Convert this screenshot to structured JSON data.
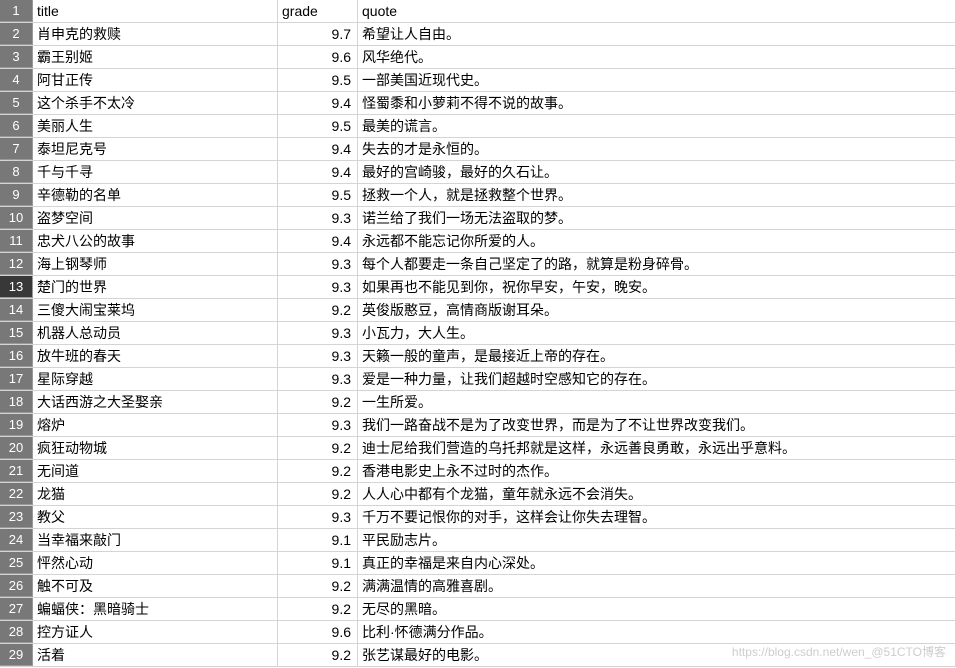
{
  "headers": {
    "title": "title",
    "grade": "grade",
    "quote": "quote"
  },
  "rows": [
    {
      "num": "1",
      "title": "title",
      "grade": "grade",
      "quote": "quote",
      "isHeader": true
    },
    {
      "num": "2",
      "title": "肖申克的救赎",
      "grade": "9.7",
      "quote": "希望让人自由。"
    },
    {
      "num": "3",
      "title": "霸王别姬",
      "grade": "9.6",
      "quote": "风华绝代。"
    },
    {
      "num": "4",
      "title": "阿甘正传",
      "grade": "9.5",
      "quote": "一部美国近现代史。"
    },
    {
      "num": "5",
      "title": "这个杀手不太冷",
      "grade": "9.4",
      "quote": "怪蜀黍和小萝莉不得不说的故事。"
    },
    {
      "num": "6",
      "title": "美丽人生",
      "grade": "9.5",
      "quote": "最美的谎言。"
    },
    {
      "num": "7",
      "title": "泰坦尼克号",
      "grade": "9.4",
      "quote": "失去的才是永恒的。"
    },
    {
      "num": "8",
      "title": "千与千寻",
      "grade": "9.4",
      "quote": "最好的宫崎骏，最好的久石让。"
    },
    {
      "num": "9",
      "title": "辛德勒的名单",
      "grade": "9.5",
      "quote": "拯救一个人，就是拯救整个世界。"
    },
    {
      "num": "10",
      "title": "盗梦空间",
      "grade": "9.3",
      "quote": "诺兰给了我们一场无法盗取的梦。"
    },
    {
      "num": "11",
      "title": "忠犬八公的故事",
      "grade": "9.4",
      "quote": "永远都不能忘记你所爱的人。"
    },
    {
      "num": "12",
      "title": "海上钢琴师",
      "grade": "9.3",
      "quote": "每个人都要走一条自己坚定了的路，就算是粉身碎骨。"
    },
    {
      "num": "13",
      "title": "楚门的世界",
      "grade": "9.3",
      "quote": "如果再也不能见到你，祝你早安，午安，晚安。",
      "dark": true
    },
    {
      "num": "14",
      "title": "三傻大闹宝莱坞",
      "grade": "9.2",
      "quote": "英俊版憨豆，高情商版谢耳朵。"
    },
    {
      "num": "15",
      "title": "机器人总动员",
      "grade": "9.3",
      "quote": "小瓦力，大人生。"
    },
    {
      "num": "16",
      "title": "放牛班的春天",
      "grade": "9.3",
      "quote": "天籁一般的童声，是最接近上帝的存在。"
    },
    {
      "num": "17",
      "title": "星际穿越",
      "grade": "9.3",
      "quote": "爱是一种力量，让我们超越时空感知它的存在。"
    },
    {
      "num": "18",
      "title": "大话西游之大圣娶亲",
      "grade": "9.2",
      "quote": "一生所爱。"
    },
    {
      "num": "19",
      "title": "熔炉",
      "grade": "9.3",
      "quote": "我们一路奋战不是为了改变世界，而是为了不让世界改变我们。"
    },
    {
      "num": "20",
      "title": "疯狂动物城",
      "grade": "9.2",
      "quote": "迪士尼给我们营造的乌托邦就是这样，永远善良勇敢，永远出乎意料。"
    },
    {
      "num": "21",
      "title": "无间道",
      "grade": "9.2",
      "quote": "香港电影史上永不过时的杰作。"
    },
    {
      "num": "22",
      "title": "龙猫",
      "grade": "9.2",
      "quote": "人人心中都有个龙猫，童年就永远不会消失。"
    },
    {
      "num": "23",
      "title": "教父",
      "grade": "9.3",
      "quote": "千万不要记恨你的对手，这样会让你失去理智。"
    },
    {
      "num": "24",
      "title": "当幸福来敲门",
      "grade": "9.1",
      "quote": "平民励志片。"
    },
    {
      "num": "25",
      "title": "怦然心动",
      "grade": "9.1",
      "quote": "真正的幸福是来自内心深处。"
    },
    {
      "num": "26",
      "title": "触不可及",
      "grade": "9.2",
      "quote": "满满温情的高雅喜剧。"
    },
    {
      "num": "27",
      "title": "蝙蝠侠：黑暗骑士",
      "grade": "9.2",
      "quote": "无尽的黑暗。"
    },
    {
      "num": "28",
      "title": "控方证人",
      "grade": "9.6",
      "quote": "比利·怀德满分作品。"
    },
    {
      "num": "29",
      "title": "活着",
      "grade": "9.2",
      "quote": "张艺谋最好的电影。"
    }
  ],
  "watermark": "https://blog.csdn.net/wen_@51CTO博客"
}
